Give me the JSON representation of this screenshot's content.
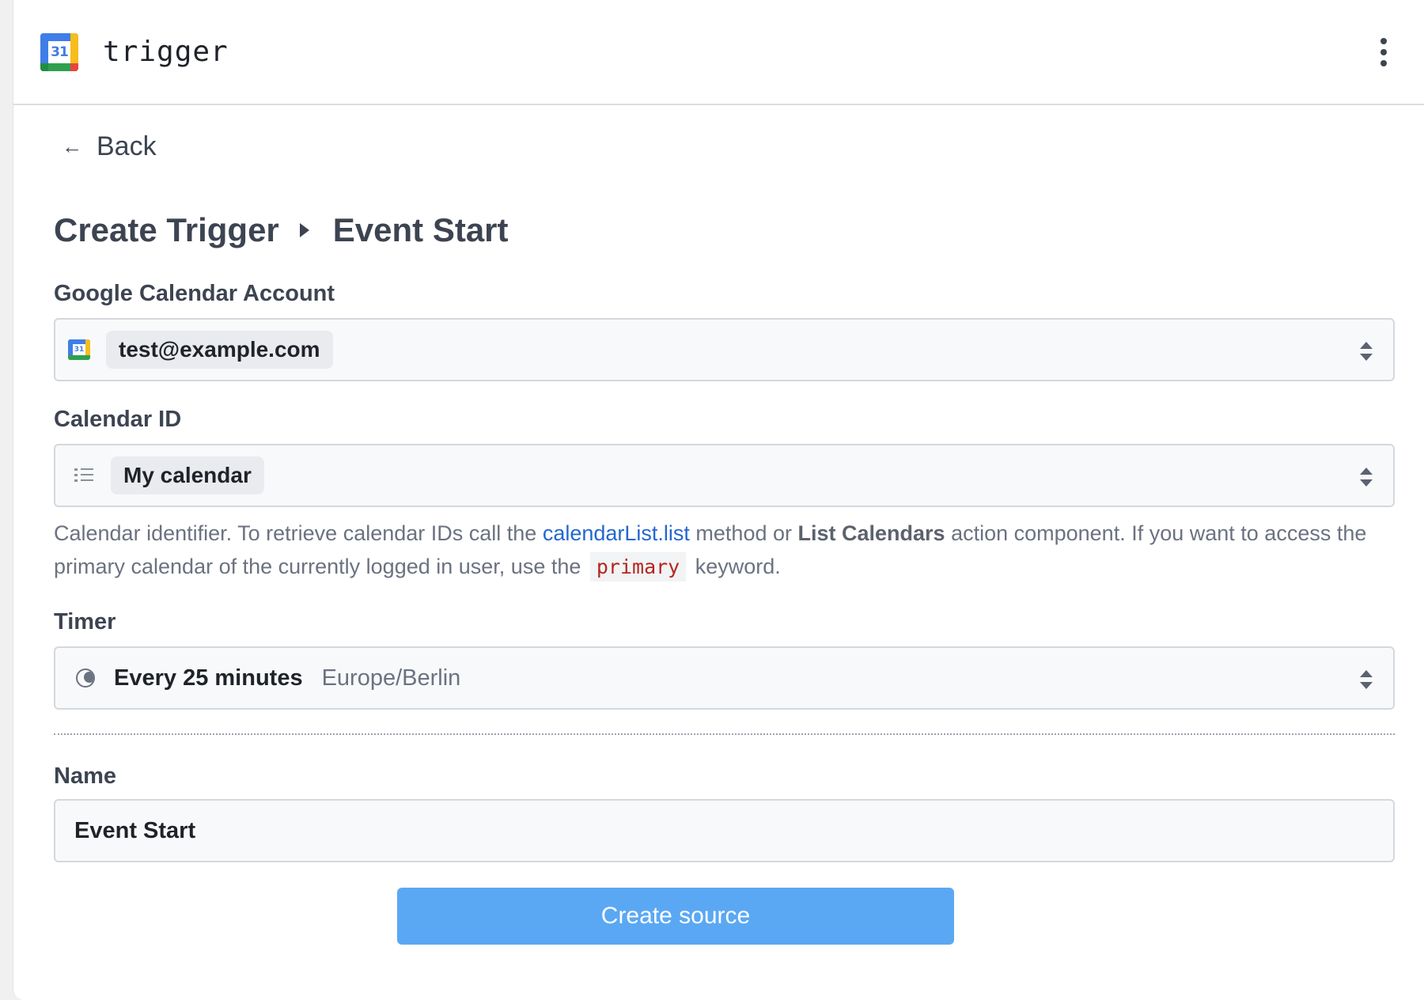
{
  "header": {
    "app_icon_text": "31",
    "title": "trigger"
  },
  "nav": {
    "back_label": "Back"
  },
  "breadcrumb": {
    "items": [
      "Create Trigger",
      "Event Start"
    ]
  },
  "form": {
    "account": {
      "label": "Google Calendar Account",
      "icon_text": "31",
      "value": "test@example.com"
    },
    "calendar_id": {
      "label": "Calendar ID",
      "value": "My calendar",
      "description": {
        "part1": "Calendar identifier. To retrieve calendar IDs call the ",
        "link": "calendarList.list",
        "part2": " method or ",
        "bold": "List Calendars",
        "part3": " action component. If you want to access the primary calendar of the currently logged in user, use the ",
        "code": "primary",
        "part4": " keyword."
      }
    },
    "timer": {
      "label": "Timer",
      "value": "Every 25 minutes",
      "timezone": "Europe/Berlin"
    },
    "name": {
      "label": "Name",
      "value": "Event Start"
    },
    "submit_label": "Create source"
  },
  "colors": {
    "accent": "#5aa8f4",
    "link": "#2367d1",
    "code": "#b3261e"
  }
}
